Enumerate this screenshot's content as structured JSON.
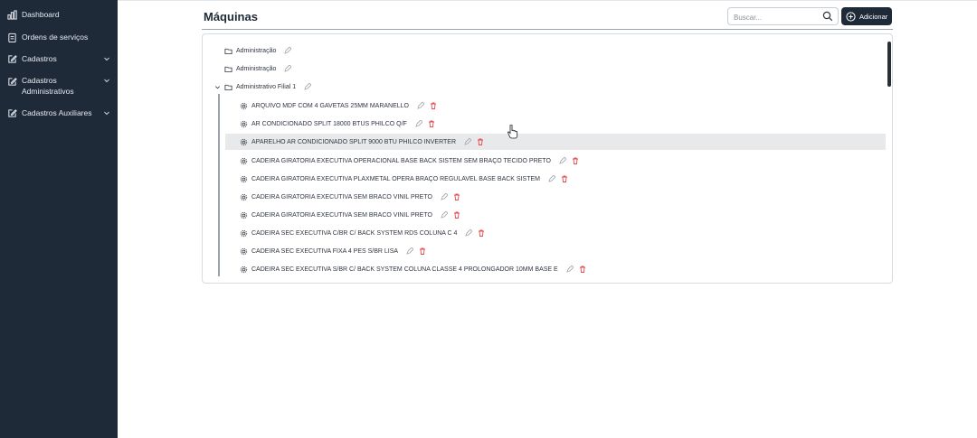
{
  "sidebar": {
    "items": [
      {
        "label": "Dashboard",
        "icon": "bar-chart-icon"
      },
      {
        "label": "Ordens de serviços",
        "icon": "clipboard-icon"
      },
      {
        "label": "Cadastros",
        "icon": "edit-square-icon",
        "has_chevron": true
      },
      {
        "label": "Cadastros Administrativos",
        "icon": "edit-square-icon",
        "has_chevron": true
      },
      {
        "label": "Cadastros Auxiliares",
        "icon": "edit-square-icon",
        "has_chevron": true
      }
    ]
  },
  "header": {
    "title": "Máquinas",
    "search_placeholder": "Buscar...",
    "add_label": "Adicionar"
  },
  "tree": {
    "folders": [
      {
        "label": "Administração"
      },
      {
        "label": "Administração"
      },
      {
        "label": "Administrativo Filial 1",
        "expanded": true
      }
    ],
    "machines": [
      {
        "label": "ARQUIVO MDF COM 4 GAVETAS 25MM MARANELLO"
      },
      {
        "label": "AR CONDICIONADO SPLIT 18000 BTUS PHILCO Q/F"
      },
      {
        "label": "APARELHO AR CONDICIONADO SPLIT 9000 BTU PHILCO INVERTER",
        "highlighted": true
      },
      {
        "label": "CADEIRA GIRATORIA EXECUTIVA OPERACIONAL BASE BACK SISTEM SEM BRAÇO TECIDO PRETO"
      },
      {
        "label": "CADEIRA GIRATORIA EXECUTIVA PLAXMETAL OPERA BRAÇO REGULAVEL BASE BACK SISTEM"
      },
      {
        "label": "CADEIRA GIRATORIA EXECUTIVA SEM BRACO VINIL PRETO"
      },
      {
        "label": "CADEIRA GIRATORIA EXECUTIVA SEM BRACO VINIL PRETO"
      },
      {
        "label": "CADEIRA SEC EXECUTIVA C/BR C/ BACK SYSTEM RDS COLUNA C 4"
      },
      {
        "label": "CADEIRA SEC EXECUTIVA FIXA 4 PES S/BR LISA"
      },
      {
        "label": "CADEIRA SEC EXECUTIVA S/BR C/ BACK SYSTEM COLUNA CLASSE 4 PROLONGADOR 10MM BASE E"
      }
    ]
  },
  "colors": {
    "sidebar_bg": "#1f2a38",
    "primary": "#1f2a38",
    "delete": "#e5484d",
    "highlight_row": "#e8e9ea"
  }
}
